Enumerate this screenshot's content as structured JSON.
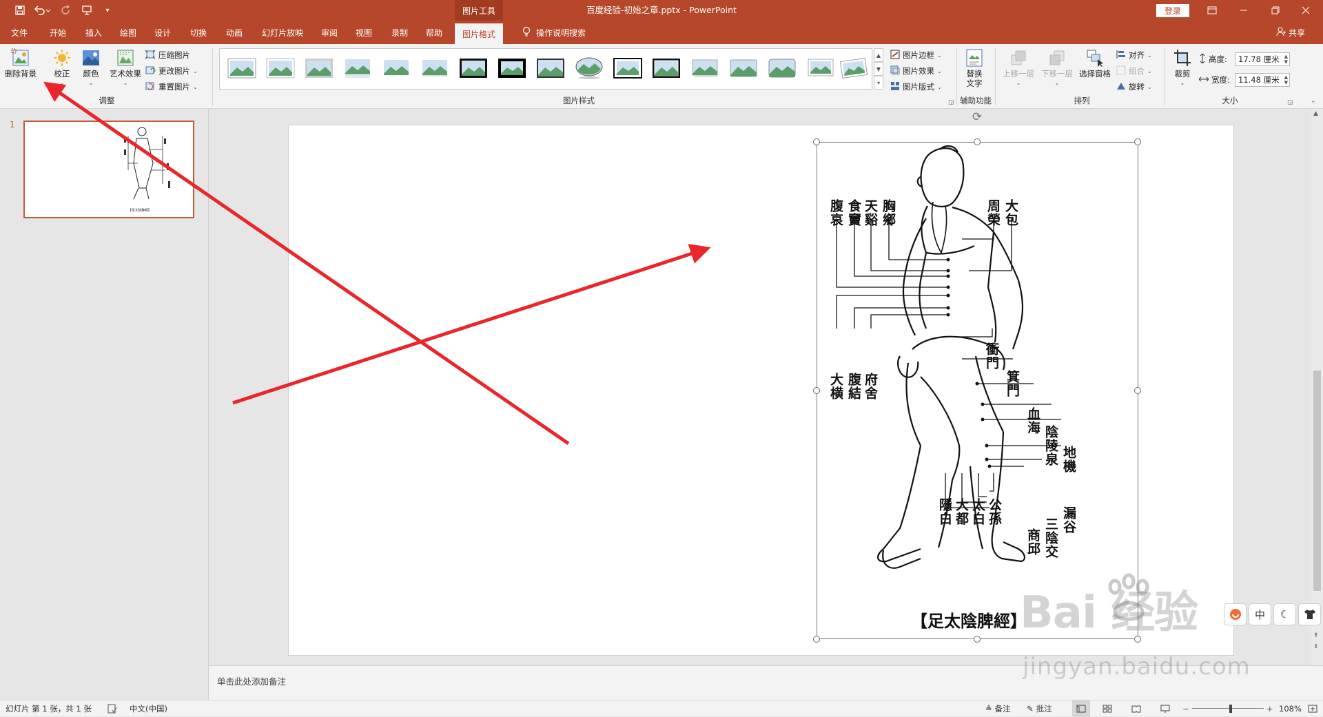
{
  "title_bar": {
    "context_group": "图片工具",
    "document_title": "百度经验-初始之章.pptx  -  PowerPoint",
    "login_label": "登录"
  },
  "tabs": [
    "文件",
    "开始",
    "插入",
    "绘图",
    "设计",
    "切换",
    "动画",
    "幻灯片放映",
    "审阅",
    "视图",
    "录制",
    "帮助",
    "图片格式"
  ],
  "active_tab": "图片格式",
  "tell_me": "操作说明搜索",
  "share_label": "共享",
  "ribbon": {
    "adjust": {
      "remove_bg": "删除背景",
      "corrections": "校正",
      "color": "颜色",
      "artistic": "艺术效果",
      "compress": "压缩图片",
      "change": "更改图片",
      "reset": "重置图片",
      "group_label": "调整"
    },
    "styles": {
      "group_label": "图片样式",
      "border": "图片边框",
      "effects": "图片效果",
      "layout": "图片版式"
    },
    "accessibility": {
      "alt_text_line1": "替换",
      "alt_text_line2": "文字",
      "group_label": "辅助功能"
    },
    "arrange": {
      "bring_forward": "上移一层",
      "send_backward": "下移一层",
      "selection_pane": "选择窗格",
      "align": "对齐",
      "group": "组合",
      "rotate": "旋转",
      "group_label": "排列"
    },
    "size": {
      "crop": "裁剪",
      "height_label": "高度:",
      "height_value": "17.78 厘米",
      "width_label": "宽度:",
      "width_value": "11.48 厘米",
      "group_label": "大小"
    }
  },
  "slides": {
    "number": "1"
  },
  "picture": {
    "labels_top_left": [
      "腹哀",
      "食竇",
      "天谿",
      "胸鄉"
    ],
    "labels_top_right": [
      "周榮",
      "大包"
    ],
    "labels_mid_left": [
      "大横",
      "腹結",
      "府舍"
    ],
    "labels_mid_right": [
      "衝門",
      "箕門"
    ],
    "labels_right": [
      "血海",
      "陰陵泉",
      "地機"
    ],
    "labels_bottom_left": [
      "隱白",
      "大都",
      "太白",
      "公孫"
    ],
    "labels_bottom_right": [
      "商邱",
      "三陰交",
      "漏谷"
    ],
    "caption": "【足太陰脾經】"
  },
  "notes_placeholder": "单击此处添加备注",
  "status": {
    "slide_info": "幻灯片 第 1 张，共 1 张",
    "language": "中文(中国)",
    "notes": "备注",
    "comments": "批注",
    "zoom": "108%"
  },
  "ime": [
    "中"
  ],
  "watermark": {
    "main": "Bai 经验",
    "url": "jingyan.baidu.com"
  },
  "colors": {
    "accent": "#b7472a",
    "arrow": "#e8262b"
  }
}
